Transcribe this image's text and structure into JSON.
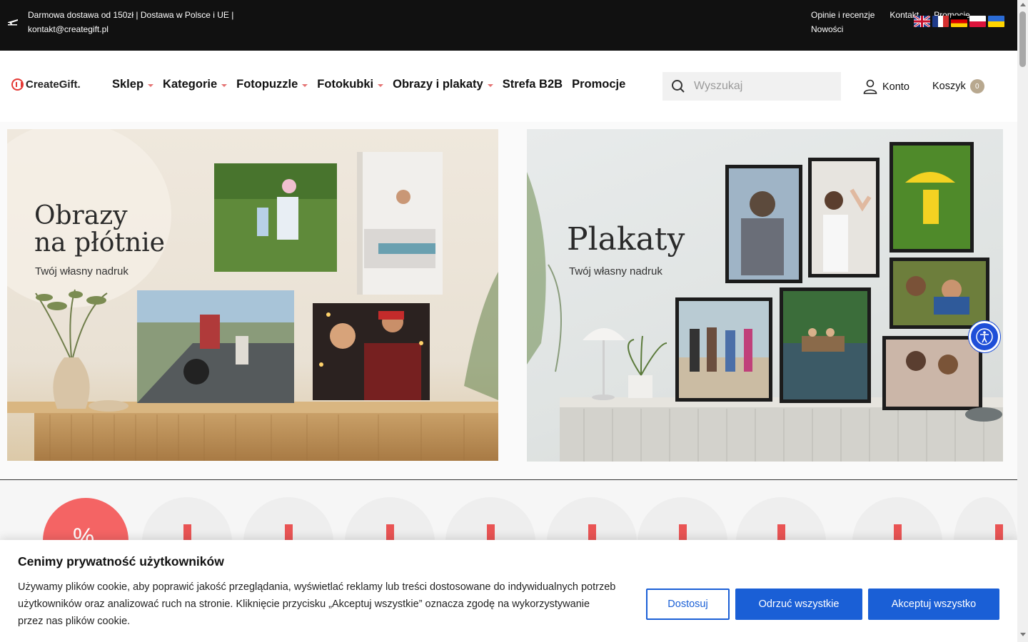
{
  "topbar": {
    "shipping_text": "Darmowa dostawa od 150zł | Dostawa w Polsce i UE | kontakt@creategift.pl",
    "links": [
      "Opinie i recenzje",
      "Kontakt",
      "Promocje",
      "Nowości"
    ]
  },
  "header": {
    "logo": "CreateGift.",
    "nav": [
      "Sklep",
      "Kategorie",
      "Fotopuzzle",
      "Fotokubki",
      "Obrazy i plakaty",
      "Strefa B2B",
      "Promocje"
    ],
    "search_placeholder": "Wyszukaj",
    "account_label": "Konto",
    "cart_label": "Koszyk",
    "cart_count": "0"
  },
  "banners": {
    "left": {
      "title_line1": "Obrazy",
      "title_line2": "na płótnie",
      "subtitle": "Twój własny nadruk"
    },
    "right": {
      "title": "Plakaty",
      "subtitle": "Twój własny nadruk"
    }
  },
  "categories": {
    "promo_symbol": "%"
  },
  "cookie": {
    "title": "Cenimy prywatność użytkowników",
    "text": "Używamy plików cookie, aby poprawić jakość przeglądania, wyświetlać reklamy lub treści dostosowane do indywidualnych potrzeb użytkowników oraz analizować ruch na stronie. Kliknięcie przycisku „Akceptuj wszystkie” oznacza zgodę na wykorzystywanie przez nas plików cookie.",
    "customize": "Dostosuj",
    "reject": "Odrzuć wszystkie",
    "accept": "Akceptuj wszystko"
  },
  "colors": {
    "topbar": "#111111",
    "accent_red": "#f46464",
    "button_blue": "#1a5fd6",
    "a11y_blue": "#1f4fd8"
  }
}
